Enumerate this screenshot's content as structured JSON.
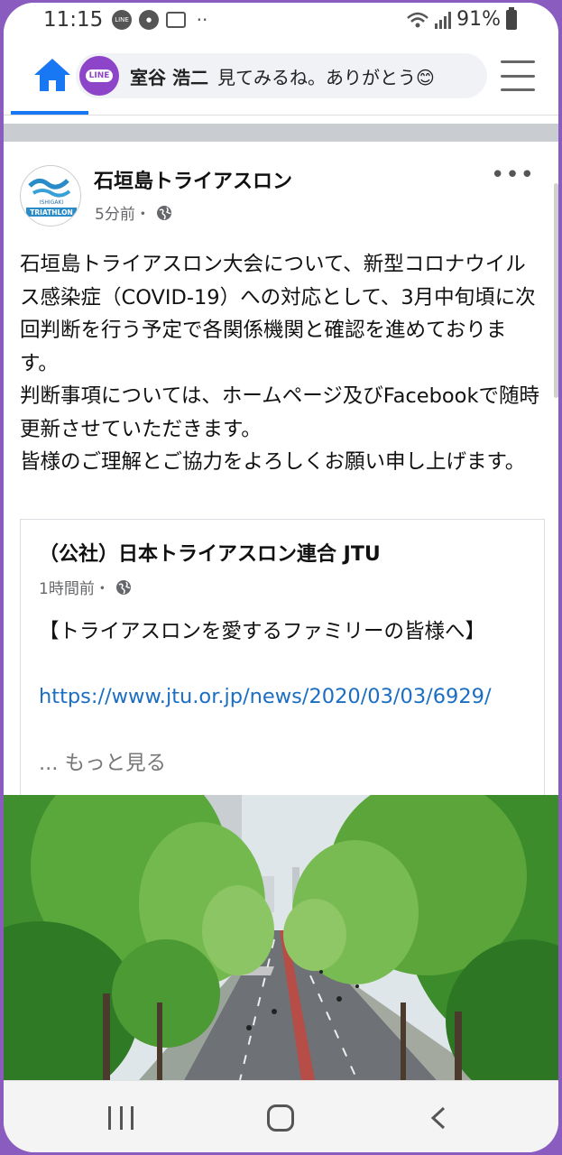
{
  "status_bar": {
    "time": "11:15",
    "battery": "91%",
    "left_icons": [
      "line-notification-icon",
      "key-icon",
      "mail-icon",
      "more-dots-icon"
    ]
  },
  "topnav": {
    "home_icon": "home-icon",
    "notification": {
      "app": "LINE",
      "sender": "室谷 浩二",
      "message": "見てみるね。ありがとう😊"
    },
    "menu_icon": "hamburger-menu-icon",
    "accent_color": "#1877f2"
  },
  "post": {
    "page_name": "石垣島トライアスロン",
    "time": "5分前・",
    "avatar_text": [
      "ISHIGAKI",
      "TRIATHLON"
    ],
    "text": "石垣島トライアスロン大会について、新型コロナウイルス感染症（COVID-19）への対応として、3月中旬頃に次回判断を行う予定で各関係機関と確認を進めております。\n判断事項については、ホームページ及びFacebookで随時更新させていただきます。\n皆様のご理解とご協力をよろしくお願い申し上げます。",
    "shared": {
      "title": "（公社）日本トライアスロン連合 JTU",
      "time": "1時間前・",
      "text": "【トライアスロンを愛するファミリーの皆様へ】",
      "link": "https://www.jtu.or.jp/news/2020/03/03/6929/",
      "see_more": "... もっと見る"
    }
  },
  "android_nav": {
    "recent": "recent-apps-icon",
    "home": "home-circle-icon",
    "back": "back-icon"
  }
}
